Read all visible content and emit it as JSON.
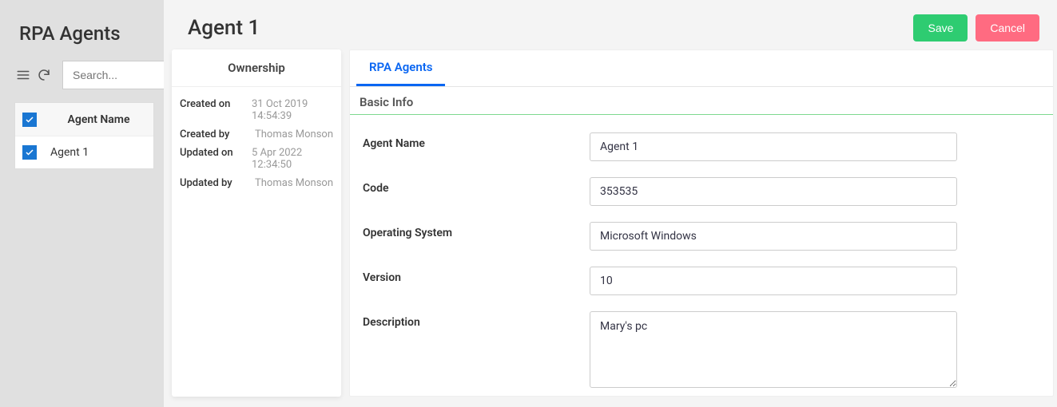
{
  "left": {
    "title": "RPA Agents",
    "search_placeholder": "Search...",
    "column_header": "Agent Name",
    "rows": [
      {
        "name": "Agent 1"
      }
    ]
  },
  "header": {
    "title": "Agent 1",
    "save_label": "Save",
    "cancel_label": "Cancel"
  },
  "ownership": {
    "title": "Ownership",
    "created_on_label": "Created on",
    "created_on_value": "31 Oct 2019 14:54:39",
    "created_by_label": "Created by",
    "created_by_value": "Thomas Monson",
    "updated_on_label": "Updated on",
    "updated_on_value": "5 Apr 2022 12:34:50",
    "updated_by_label": "Updated by",
    "updated_by_value": "Thomas Monson"
  },
  "detail": {
    "tab_label": "RPA Agents",
    "section_title": "Basic Info",
    "fields": {
      "agent_name_label": "Agent Name",
      "agent_name_value": "Agent 1",
      "code_label": "Code",
      "code_value": "353535",
      "os_label": "Operating System",
      "os_value": "Microsoft Windows",
      "version_label": "Version",
      "version_value": "10",
      "description_label": "Description",
      "description_value": "Mary's pc"
    }
  }
}
